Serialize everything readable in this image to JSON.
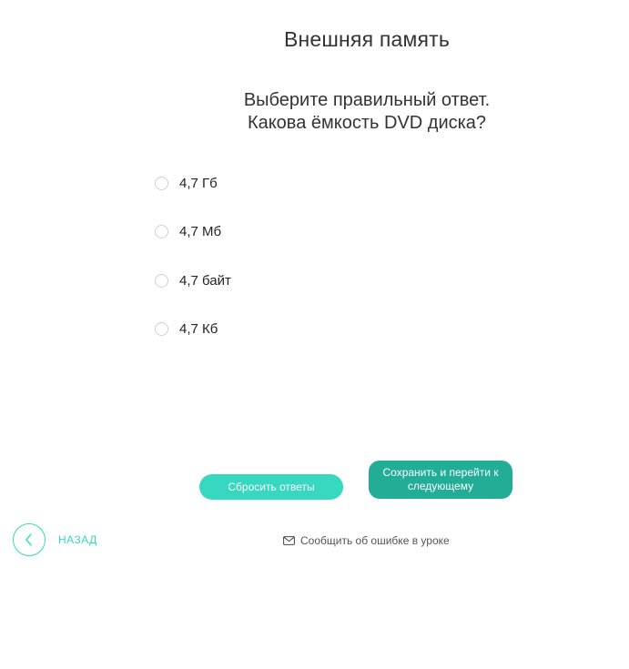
{
  "lesson": {
    "title": "Внешняя память"
  },
  "question": {
    "instruction": "Выберите правильный ответ.",
    "text": "Какова ёмкость DVD диска?"
  },
  "options": [
    {
      "label": "4,7 Гб",
      "selected": false
    },
    {
      "label": "4,7 Мб",
      "selected": false
    },
    {
      "label": "4,7 байт",
      "selected": false
    },
    {
      "label": "4,7 Кб",
      "selected": false
    }
  ],
  "buttons": {
    "reset_label": "Сбросить ответы",
    "save_label": "Сохранить и перейти к следующему"
  },
  "nav": {
    "back_label": "НАЗАД",
    "back_icon": "chevron-left-icon"
  },
  "report": {
    "label": "Сообщить об ошибке в уроке",
    "icon": "mail-icon"
  },
  "colors": {
    "accent": "#36d8bf",
    "accent_dark": "#21ad96",
    "radio_border": "#cfcfcf"
  }
}
